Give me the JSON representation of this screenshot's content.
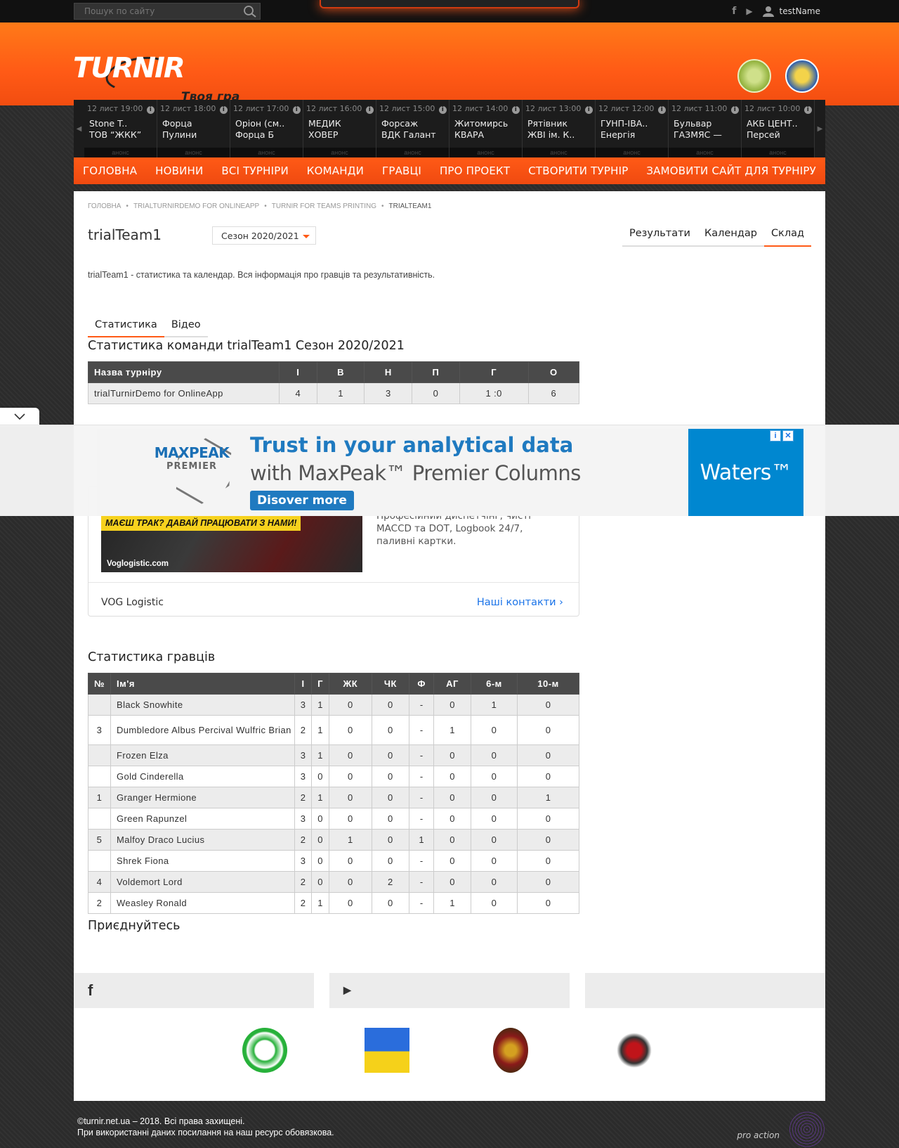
{
  "topbar": {
    "search_placeholder": "Пошук по сайту",
    "username": "testName",
    "fb": "f",
    "play": "▶"
  },
  "header": {
    "logo": "TURNIR",
    "slogan": "Твоя гра"
  },
  "ticker": [
    {
      "time": "12 лист 19:00",
      "t1": "Stone T..",
      "t2": "ТОВ “ЖКК”",
      "anons": "анонс"
    },
    {
      "time": "12 лист 18:00",
      "t1": "Форца",
      "t2": "Пулини",
      "anons": "анонс"
    },
    {
      "time": "12 лист 17:00",
      "t1": "Оріон (см..",
      "t2": "Форца Б",
      "anons": "анонс"
    },
    {
      "time": "12 лист 16:00",
      "t1": "МЕДИК",
      "t2": "ХОВЕР",
      "anons": "анонс"
    },
    {
      "time": "12 лист 15:00",
      "t1": "Форсаж",
      "t2": "ВДК Галант",
      "anons": "анонс"
    },
    {
      "time": "12 лист 14:00",
      "t1": "Житомирсь",
      "t2": "КВАРА",
      "anons": "анонс"
    },
    {
      "time": "12 лист 13:00",
      "t1": "Рятівник",
      "t2": "ЖВІ ім. К..",
      "anons": "анонс"
    },
    {
      "time": "12 лист 12:00",
      "t1": "ГУНП-ІВА..",
      "t2": "Енергія",
      "anons": "анонс"
    },
    {
      "time": "12 лист 11:00",
      "t1": "Бульвар",
      "t2": "ГАЗМЯС —",
      "anons": "анонс"
    },
    {
      "time": "12 лист 10:00",
      "t1": "АКБ ЦЕНТ..",
      "t2": "Персей",
      "anons": "анонс"
    }
  ],
  "nav": [
    "ГОЛОВНА",
    "НОВИНИ",
    "ВСІ ТУРНІРИ",
    "КОМАНДИ",
    "ГРАВЦІ",
    "ПРО ПРОЕКТ",
    "СТВОРИТИ ТУРНІР",
    "ЗАМОВИТИ САЙТ ДЛЯ ТУРНІРУ"
  ],
  "breadcrumb": [
    "ГОЛОВНА",
    "TRIALTURNIRDEMO FOR ONLINEAPP",
    "TURNIR FOR TEAMS PRINTING",
    "TRIALTEAM1"
  ],
  "team": {
    "title": "trialTeam1",
    "season": "Сезон 2020/2021",
    "tabs": [
      "Результати",
      "Календар",
      "Склад"
    ],
    "active_tab": "Склад",
    "description": "trialTeam1 - статистика та календар. Вся інформація про гравців та результативність."
  },
  "stat_tabs": [
    "Статистика",
    "Відео"
  ],
  "team_stats": {
    "heading": "Статистика команди trialTeam1 Сезон 2020/2021",
    "columns": [
      "Назва турніру",
      "І",
      "В",
      "Н",
      "П",
      "Г",
      "О"
    ],
    "rows": [
      [
        "trialTurnirDemo for OnlineApp",
        "4",
        "1",
        "3",
        "0",
        "1 :0",
        "6"
      ]
    ]
  },
  "ad_card": {
    "yellow_text": "МАЄШ ТРАК? ДАВАЙ ПРАЦЮВАТИ З НАМИ!",
    "site": "Voglogistic.com",
    "text": "Професійний диспетчінг, чисті MACCD та DOT, Logbook 24/7, паливні картки.",
    "brand": "VOG Logistic",
    "contact": "Наші контакти"
  },
  "player_stats": {
    "heading": "Статистика гравців",
    "columns": [
      "№",
      "Ім'я",
      "І",
      "Г",
      "ЖК",
      "ЧК",
      "Ф",
      "АГ",
      "6-м",
      "10-м"
    ],
    "rows": [
      [
        "",
        "Black Snowhite",
        "3",
        "1",
        "0",
        "0",
        "-",
        "0",
        "1",
        "0"
      ],
      [
        "3",
        "Dumbledore Albus Percival Wulfric Brian",
        "2",
        "1",
        "0",
        "0",
        "-",
        "1",
        "0",
        "0"
      ],
      [
        "",
        "Frozen Elza",
        "3",
        "1",
        "0",
        "0",
        "-",
        "0",
        "0",
        "0"
      ],
      [
        "",
        "Gold Cinderella",
        "3",
        "0",
        "0",
        "0",
        "-",
        "0",
        "0",
        "0"
      ],
      [
        "1",
        "Granger Hermione",
        "2",
        "1",
        "0",
        "0",
        "-",
        "0",
        "0",
        "1"
      ],
      [
        "",
        "Green Rapunzel",
        "3",
        "0",
        "0",
        "0",
        "-",
        "0",
        "0",
        "0"
      ],
      [
        "5",
        "Malfoy Draco Lucius",
        "2",
        "0",
        "1",
        "0",
        "1",
        "0",
        "0",
        "0"
      ],
      [
        "",
        "Shrek Fiona",
        "3",
        "0",
        "0",
        "0",
        "-",
        "0",
        "0",
        "0"
      ],
      [
        "4",
        "Voldemort Lord",
        "2",
        "0",
        "0",
        "2",
        "-",
        "0",
        "0",
        "0"
      ],
      [
        "2",
        "Weasley Ronald",
        "2",
        "1",
        "0",
        "0",
        "-",
        "1",
        "0",
        "0"
      ]
    ]
  },
  "join": {
    "heading": "Приєднуйтесь",
    "fb_icon": "f",
    "yt_icon": "▶"
  },
  "footer": {
    "line1": "©turnir.net.ua – 2018. Всі права захищені.",
    "line2": "При використанні даних посилання на наш ресурс обовязкова.",
    "pro": "pro action"
  },
  "banner": {
    "logo1": "MAXPEAK",
    "logo2": "PREMIER",
    "line1": "Trust in your analytical data",
    "line2": "with MaxPeak™ Premier Columns",
    "cta": "Disover more",
    "brand": "Waters™",
    "adchoice_i": "i",
    "adchoice_x": "✕"
  },
  "colors": {
    "accent": "#ff5a16",
    "table_header": "#4a4a4a",
    "ad_blue": "#1f7ac0"
  }
}
